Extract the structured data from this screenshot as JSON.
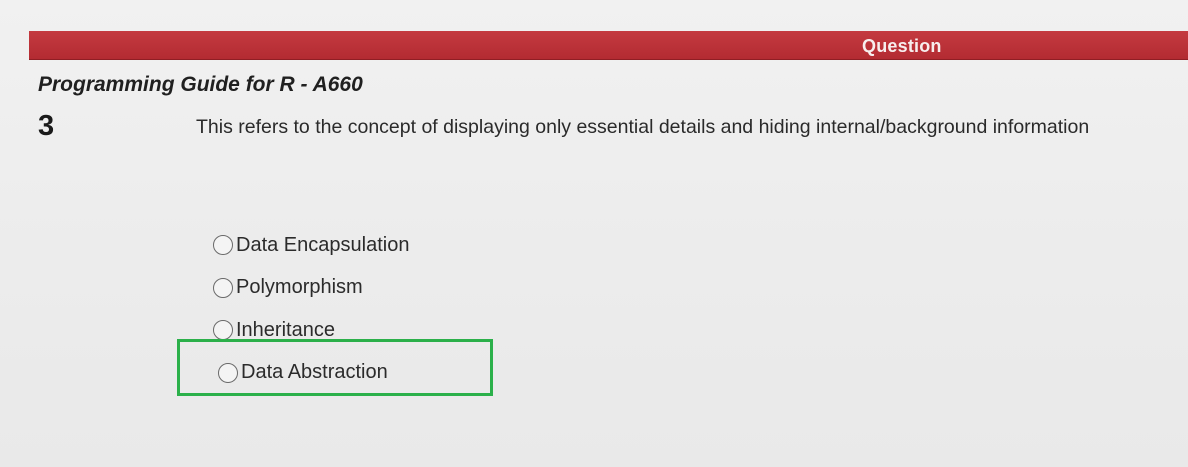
{
  "header": {
    "title": "Question"
  },
  "course": {
    "title": "Programming Guide for R - A660"
  },
  "question": {
    "number": "3",
    "text": "This refers to the concept of displaying only essential details and hiding internal/background information"
  },
  "options": [
    {
      "label": "Data Encapsulation",
      "selected": false
    },
    {
      "label": "Polymorphism",
      "selected": false
    },
    {
      "label": "Inheritance",
      "selected": false
    },
    {
      "label": "Data Abstraction",
      "selected": false,
      "highlighted": true
    }
  ],
  "colors": {
    "header_bar": "#b83238",
    "header_text": "#f7eeee",
    "highlight_border": "#2bb04a",
    "background": "#eeeeee"
  },
  "icons": {
    "radio": "radio-button-unchecked-icon"
  }
}
